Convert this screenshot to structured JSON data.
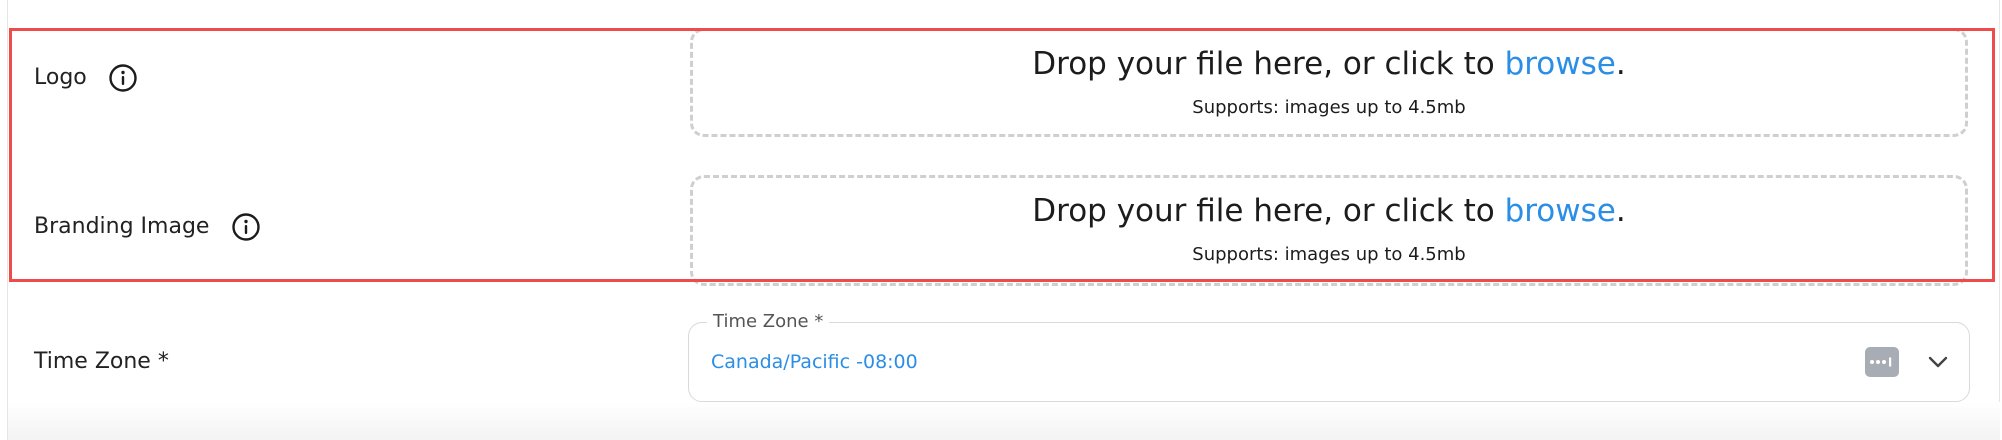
{
  "form": {
    "rows": [
      {
        "label": "Logo",
        "info_icon": "info-circle-icon",
        "dropzone": {
          "prompt_prefix": "Drop your file here, or click to ",
          "link_text": "browse",
          "prompt_suffix": ".",
          "support_text": "Supports: images up to 4.5mb"
        }
      },
      {
        "label": "Branding Image",
        "info_icon": "info-circle-icon",
        "dropzone": {
          "prompt_prefix": "Drop your file here, or click to ",
          "link_text": "browse",
          "prompt_suffix": ".",
          "support_text": "Supports: images up to 4.5mb"
        }
      }
    ],
    "time_zone": {
      "label": "Time Zone *",
      "field_legend": "Time Zone *",
      "value": "Canada/Pacific -08:00",
      "password_manager_icon": "password-manager-icon",
      "dropdown_icon": "chevron-down-icon"
    }
  },
  "colors": {
    "accent": "#2b8ee6",
    "highlight_border": "#ee4b4b",
    "dashed_border": "#cfcfcf"
  }
}
